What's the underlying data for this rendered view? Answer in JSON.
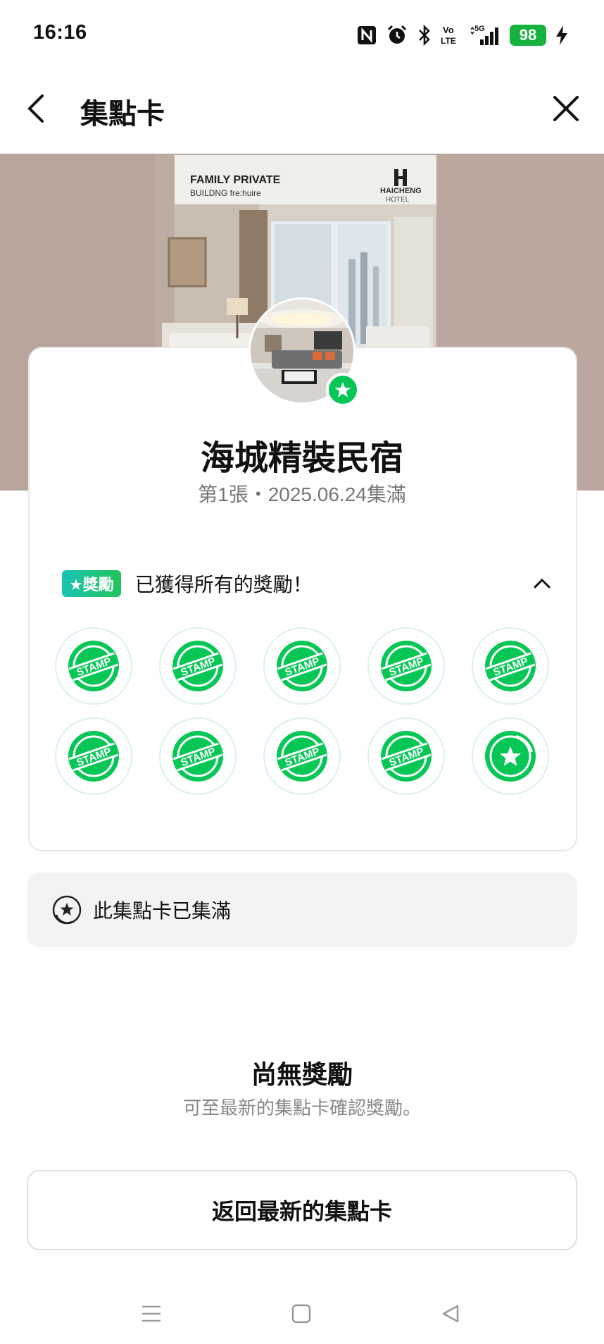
{
  "status_bar": {
    "time": "16:16",
    "battery": "98",
    "icons": [
      "nfc-icon",
      "alarm-icon",
      "bluetooth-icon",
      "volte-icon",
      "signal-5g-icon",
      "battery-icon",
      "charging-icon"
    ]
  },
  "nav": {
    "title": "集點卡",
    "back_icon": "chevron-left-icon",
    "close_icon": "close-icon"
  },
  "hero": {
    "brand_line1": "FAMILY PRIVATE",
    "brand_line2": "BUILDNG fre:huire",
    "logo_text1": "HAICHENG",
    "logo_text2": "HOTEL"
  },
  "card": {
    "shop_name": "海城精裝民宿",
    "meta": "第1張・2025.06.24集滿",
    "reward_badge": "★獎勵",
    "reward_text": "已獲得所有的獎勵！",
    "stamps": [
      {
        "type": "stamp",
        "label": "STAMP"
      },
      {
        "type": "stamp",
        "label": "STAMP"
      },
      {
        "type": "stamp",
        "label": "STAMP"
      },
      {
        "type": "stamp",
        "label": "STAMP"
      },
      {
        "type": "stamp",
        "label": "STAMP"
      },
      {
        "type": "stamp",
        "label": "STAMP"
      },
      {
        "type": "stamp",
        "label": "STAMP"
      },
      {
        "type": "stamp",
        "label": "STAMP"
      },
      {
        "type": "stamp",
        "label": "STAMP"
      },
      {
        "type": "star",
        "label": ""
      }
    ]
  },
  "full_notice": "此集點卡已集滿",
  "empty": {
    "title": "尚無獎勵",
    "desc": "可至最新的集點卡確認獎勵。"
  },
  "back_button": "返回最新的集點卡",
  "colors": {
    "accent_green": "#06c755",
    "badge_gradient_start": "#19c4b4",
    "battery_green": "#16b13f"
  }
}
